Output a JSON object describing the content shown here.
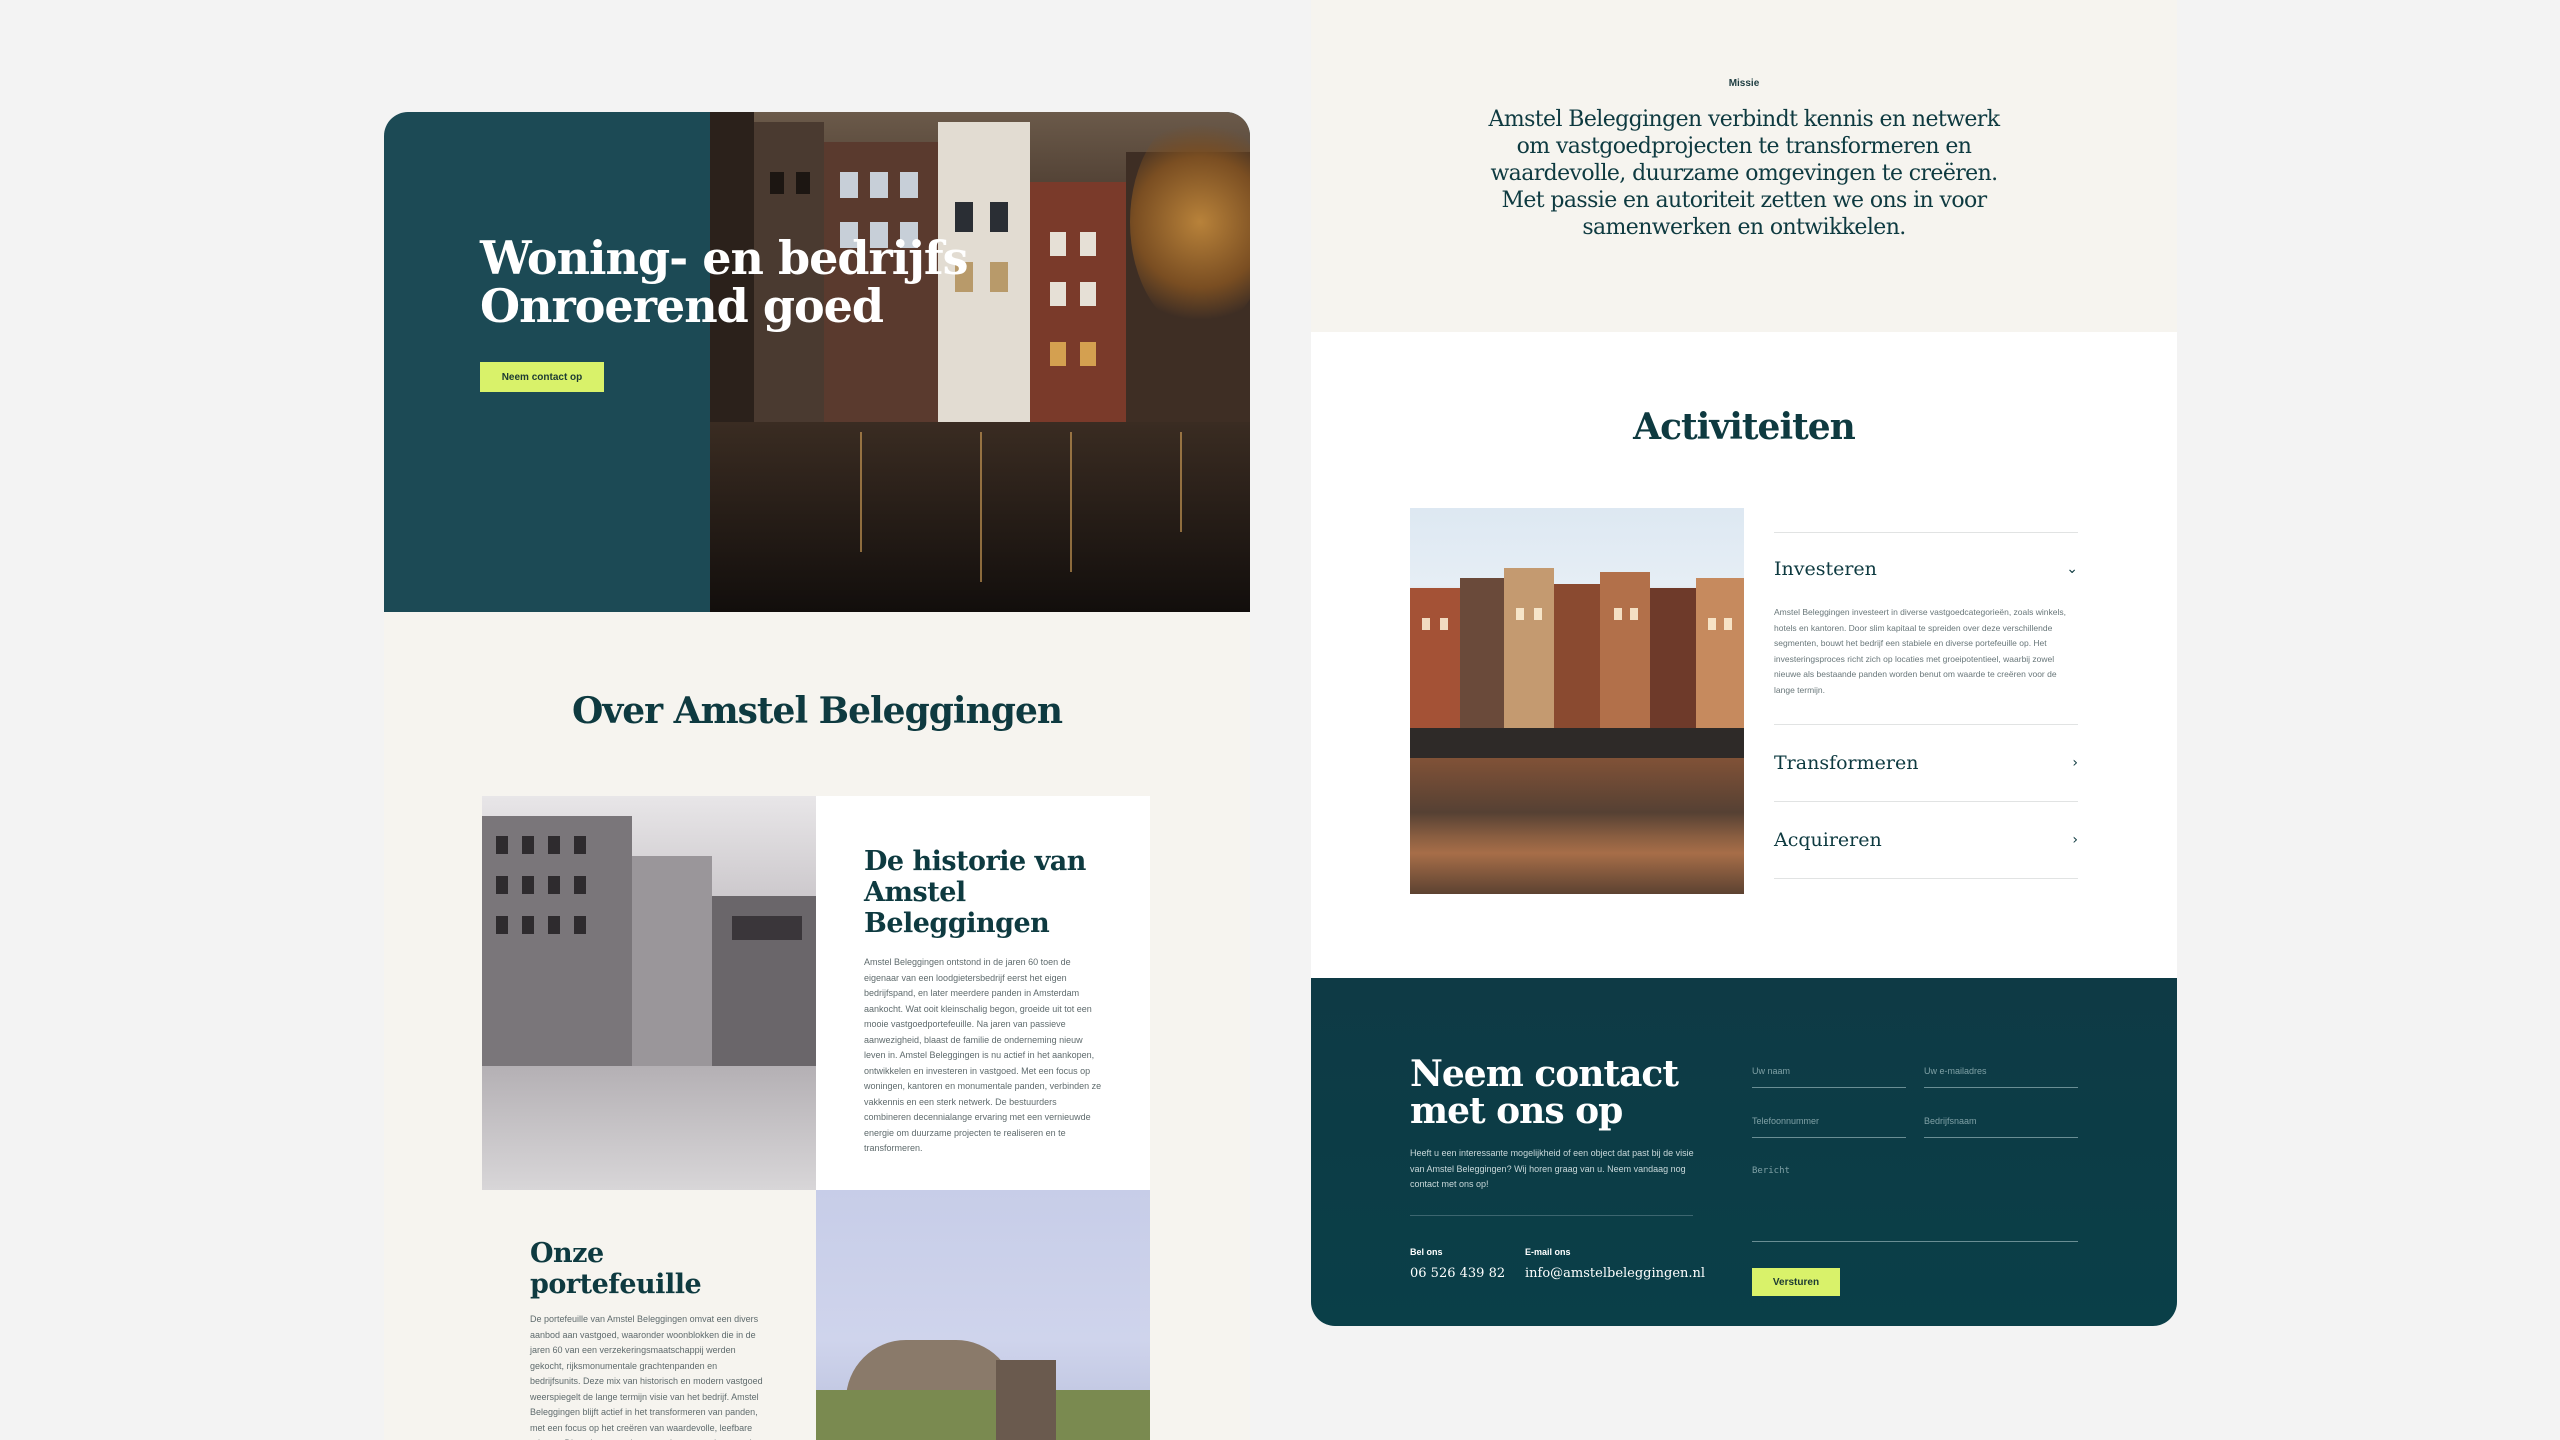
{
  "hero": {
    "title_line1": "Woning- en bedrijfs",
    "title_line2": "Onroerend goed",
    "cta": "Neem contact op"
  },
  "about": {
    "title": "Over Amstel Beleggingen",
    "history": {
      "title": "De historie van Amstel Beleggingen",
      "text": "Amstel Beleggingen ontstond in de jaren 60 toen de eigenaar van een loodgietersbedrijf eerst het eigen bedrijfspand, en later meerdere panden in Amsterdam aankocht. Wat ooit kleinschalig begon, groeide uit tot een mooie vastgoedportefeuille. Na jaren van passieve aanwezigheid, blaast de familie de onderneming nieuw leven in. Amstel Beleggingen is nu actief in het aankopen, ontwikkelen en investeren in vastgoed. Met een focus op woningen, kantoren en monumentale panden, verbinden ze vakkennis en een sterk netwerk. De bestuurders combineren decennialange ervaring met een vernieuwde energie om duurzame projecten te realiseren en te transformeren."
    },
    "portfolio": {
      "title": "Onze portefeuille",
      "text": "De portefeuille van Amstel Beleggingen omvat een divers aanbod aan vastgoed, waaronder woonblokken die in de jaren 60 van een verzekeringsmaatschappij werden gekocht, rijksmonumentale grachtenpanden en bedrijfsunits. Deze mix van historisch en modern vastgoed weerspiegelt de lange termijn visie van het bedrijf. Amstel Beleggingen blijft actief in het transformeren van panden, met een focus op het creëren van waardevolle, leefbare ruimtes. Dit varieert van de renovatie van grachtenpanden tot de"
    }
  },
  "mission": {
    "label": "Missie",
    "text": "Amstel Beleggingen verbindt kennis en netwerk om vastgoedprojecten te transformeren en waardevolle, duurzame omgevingen te creëren. Met passie en autoriteit zetten we ons in voor samenwerken en ontwikkelen."
  },
  "activities": {
    "title": "Activiteiten",
    "items": [
      {
        "label": "Investeren",
        "text": "Amstel Beleggingen investeert in diverse vastgoedcategorieën, zoals winkels, hotels en kantoren. Door slim kapitaal te spreiden over deze verschillende segmenten, bouwt het bedrijf een stabiele en diverse portefeuille op. Het investeringsproces richt zich op locaties met groeipotentieel, waarbij zowel nieuwe als bestaande panden worden benut om waarde te creëren voor de lange termijn."
      },
      {
        "label": "Transformeren"
      },
      {
        "label": "Acquireren"
      }
    ]
  },
  "contact": {
    "title_line1": "Neem contact",
    "title_line2": "met ons op",
    "text": "Heeft u een interessante mogelijkheid of een object dat past bij de visie van Amstel Beleggingen? Wij horen graag van u. Neem vandaag nog contact met ons op!",
    "phone_label": "Bel ons",
    "phone": "06 526 439 82",
    "email_label": "E-mail ons",
    "email": "info@amstelbeleggingen.nl",
    "fields": {
      "name": "Uw naam",
      "email": "Uw e-mailadres",
      "phone": "Telefoonnummer",
      "company": "Bedrijfsnaam",
      "message": "Bericht"
    },
    "submit": "Versturen"
  },
  "colors": {
    "primary": "#1c4a55",
    "accent": "#d9f26a",
    "cream": "#f6f4ef",
    "heading": "#0e3a40"
  }
}
